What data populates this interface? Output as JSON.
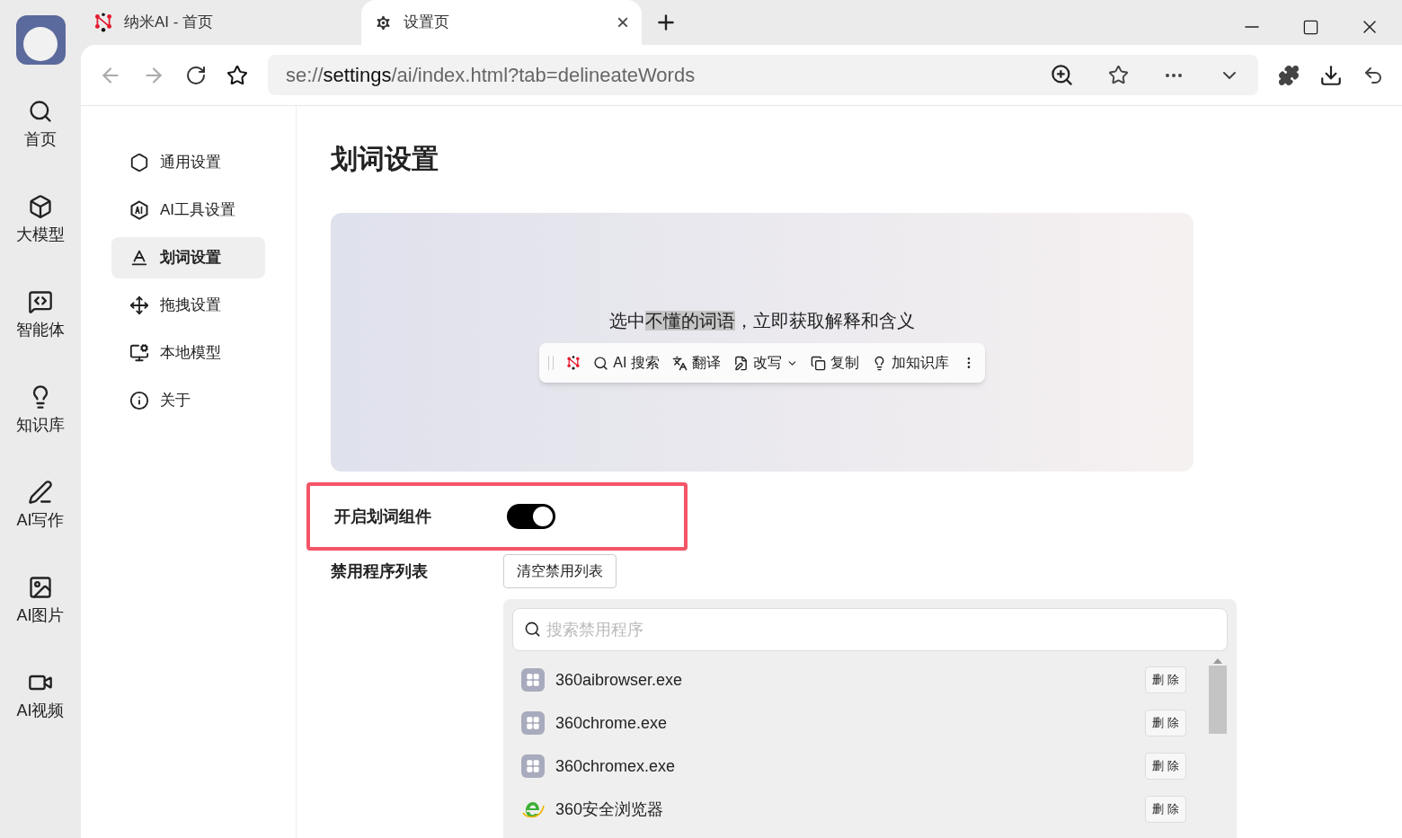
{
  "rail": [
    {
      "label": "首页"
    },
    {
      "label": "大模型"
    },
    {
      "label": "智能体"
    },
    {
      "label": "知识库"
    },
    {
      "label": "AI写作"
    },
    {
      "label": "AI图片"
    },
    {
      "label": "AI视频"
    }
  ],
  "tabs": [
    {
      "title": "纳米AI - 首页",
      "selected": false
    },
    {
      "title": "设置页",
      "selected": true,
      "close": "×"
    }
  ],
  "address": {
    "prefix": "se://",
    "host": "settings",
    "path": "/ai/index.html?tab=delineateWords"
  },
  "nav": [
    {
      "label": "通用设置",
      "selected": false
    },
    {
      "label": "AI工具设置",
      "selected": false
    },
    {
      "label": "划词设置",
      "selected": true
    },
    {
      "label": "拖拽设置",
      "selected": false
    },
    {
      "label": "本地模型",
      "selected": false
    },
    {
      "label": "关于",
      "selected": false
    }
  ],
  "page_title": "划词设置",
  "preview": {
    "caption": [
      {
        "text": "选中",
        "highlighted": false
      },
      {
        "text": "不懂的词语",
        "highlighted": true
      },
      {
        "text": "，立即获取解释和含义",
        "highlighted": false
      }
    ],
    "toolbar": [
      {
        "label": "AI 搜索",
        "dropdown": false
      },
      {
        "label": "翻译",
        "dropdown": false
      },
      {
        "label": "改写",
        "dropdown": true
      },
      {
        "label": "复制",
        "dropdown": false
      },
      {
        "label": "加知识库",
        "dropdown": false
      }
    ]
  },
  "toggle_setting": {
    "label": "开启划词组件",
    "on": true,
    "highlighted": true
  },
  "blocklist": {
    "label": "禁用程序列表",
    "clear_button": "清空禁用列表",
    "search": {
      "placeholder": "搜索禁用程序"
    },
    "rows": [
      {
        "name": "360aibrowser.exe",
        "kind": "generic",
        "action": "删 除"
      },
      {
        "name": "360chrome.exe",
        "kind": "generic",
        "action": "删 除"
      },
      {
        "name": "360chromex.exe",
        "kind": "generic",
        "action": "删 除"
      },
      {
        "name": "360安全浏览器",
        "kind": "ie",
        "action": "删 除"
      }
    ]
  }
}
